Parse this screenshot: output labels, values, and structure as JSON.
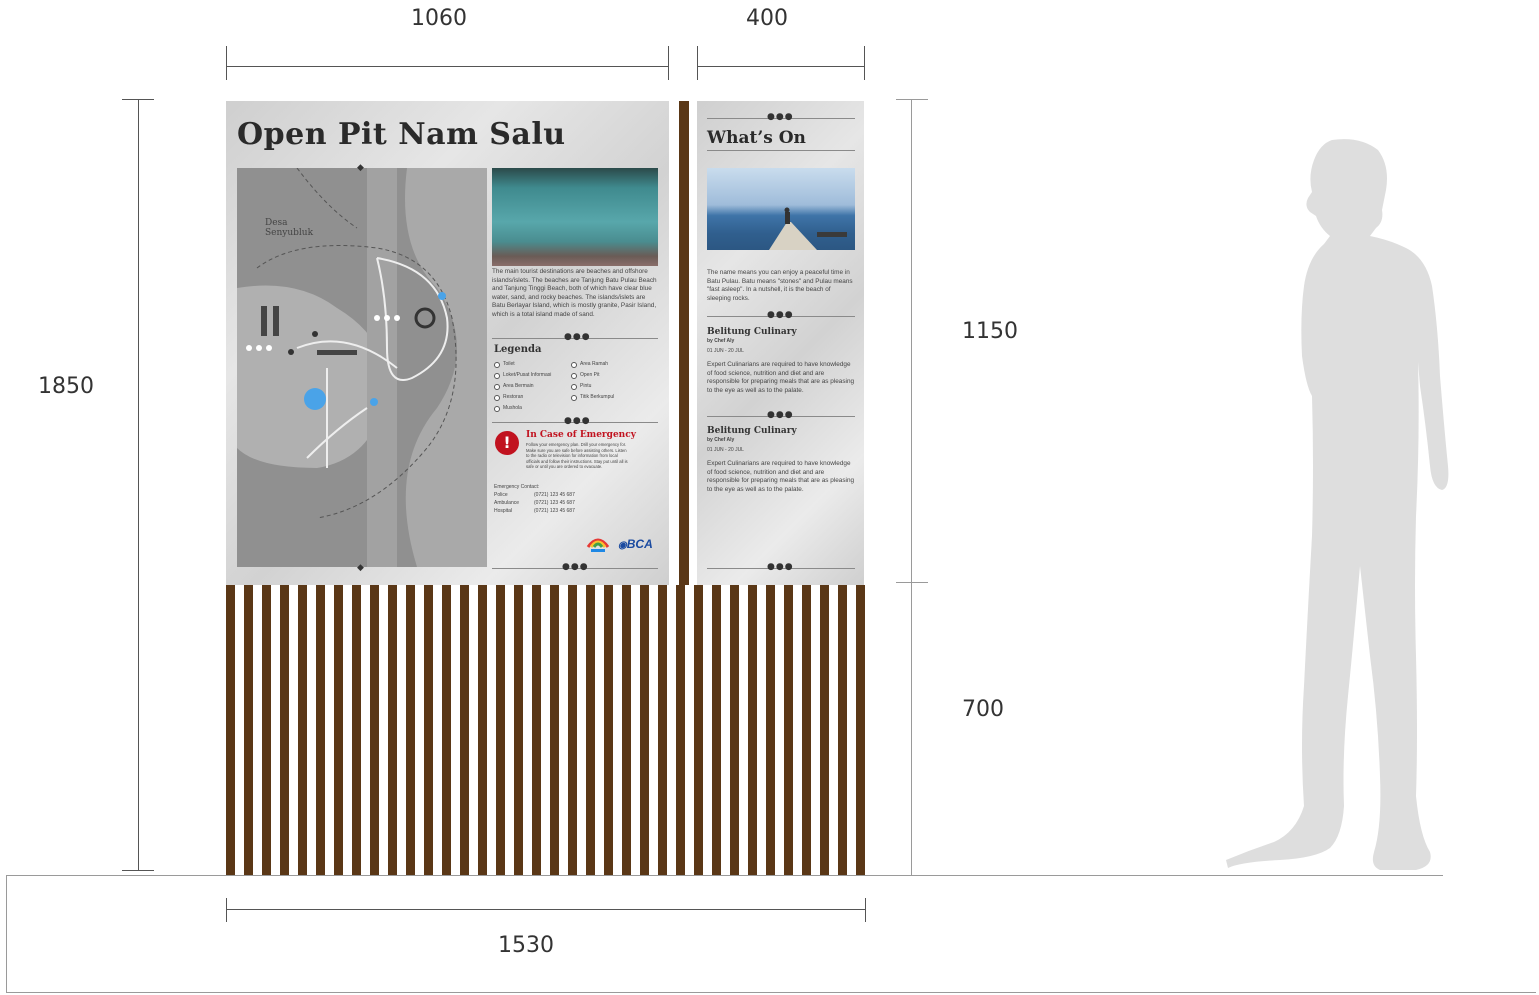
{
  "dimensions": {
    "top_left": "1060",
    "top_right": "400",
    "left_total": "1850",
    "right_upper": "1150",
    "right_lower": "700",
    "bottom_total": "1530"
  },
  "main_panel": {
    "title": "Open Pit Nam Salu",
    "map_label": "Desa\nSenyubluk",
    "intro": "The main tourist destinations are beaches and offshore islands/islets. The beaches are Tanjung Batu Pulau Beach and Tanjung Tinggi Beach, both of which have clear blue water, sand, and rocky beaches. The islands/islets are Batu Berlayar Island, which is mostly granite, Pasir Island, which is a total island made of sand.",
    "legend_title": "Legenda",
    "legend_items_left": [
      "Toilet",
      "Loket/Pusat Informasi",
      "Area Bermain",
      "Restoran",
      "Mushola"
    ],
    "legend_items_right": [
      "Area Ramah",
      "Open Pit",
      "Pintu",
      "Titik Berkumpul"
    ],
    "emergency_title": "In Case of Emergency",
    "emergency_text": "Follow your emergency plan. Drill your emergency for. Make sure you are safe before assisting others. Listen to the radio or television for information from local officials and follow their instructions. Stay put until all is safe or until you are ordered to evacuate.",
    "contacts_title": "Emergency Contact:",
    "contacts": [
      {
        "label": "Police",
        "number": "(0721) 123 45 687"
      },
      {
        "label": "Ambulance",
        "number": "(0721) 123 45 687"
      },
      {
        "label": "Hospital",
        "number": "(0721) 123 45 687"
      }
    ],
    "sponsor_logo": "BCA"
  },
  "side_panel": {
    "title": "What’s On",
    "intro": "The name means you can enjoy a peaceful time in Batu Pulau. Batu means \"stones\" and Pulau means \"fast asleep\". In a nutshell, it is the beach of sleeping rocks.",
    "events": [
      {
        "title": "Belitung Culinary",
        "subtitle": "by Chef Aly",
        "date": "01 JUN - 20 JUL",
        "text": "Expert Culinarians are required to have knowledge of food science, nutrition and diet and are responsible for preparing meals that are as pleasing to the eye as well as to the palate."
      },
      {
        "title": "Belitung Culinary",
        "subtitle": "by Chef Aly",
        "date": "01 JUN - 20 JUL",
        "text": "Expert Culinarians are required to have knowledge of food science, nutrition and diet and are responsible for preparing meals that are as pleasing to the eye as well as to the palate."
      }
    ]
  },
  "colors": {
    "wood": "#5a3716",
    "emergency_red": "#c1121f",
    "panel": "#dcdcdc",
    "silhouette": "#dedede"
  }
}
